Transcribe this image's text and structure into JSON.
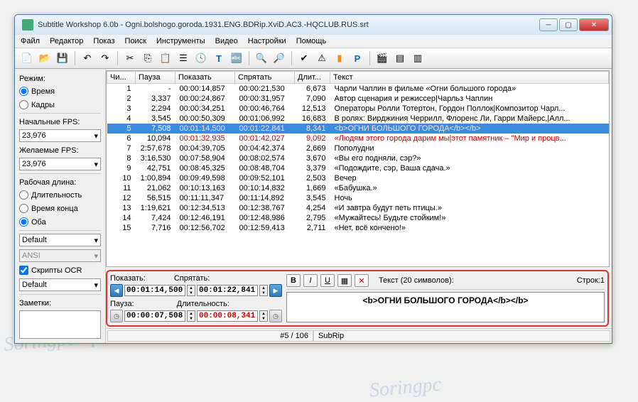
{
  "title": "Subtitle Workshop 6.0b - Ogni.bolshogo.goroda.1931.ENG.BDRip.XviD.AC3.-HQCLUB.RUS.srt",
  "menu": [
    "Файл",
    "Редактор",
    "Показ",
    "Поиск",
    "Инструменты",
    "Видео",
    "Настройки",
    "Помощь"
  ],
  "sidebar": {
    "mode_label": "Режим:",
    "mode_time": "Время",
    "mode_frames": "Кадры",
    "start_fps_label": "Начальные FPS:",
    "start_fps": "23,976",
    "want_fps_label": "Желаемые FPS:",
    "want_fps": "23,976",
    "worklen_label": "Рабочая длина:",
    "worklen_dur": "Длительность",
    "worklen_end": "Время конца",
    "worklen_both": "Оба",
    "combo1": "Default",
    "combo2": "ANSI",
    "ocr_label": "Скрипты OCR",
    "combo3": "Default",
    "notes": "Заметки:"
  },
  "cols": {
    "num": "Чи...",
    "pause": "Пауза",
    "show": "Показать",
    "hide": "Спрятать",
    "dur": "Длит...",
    "text": "Текст"
  },
  "rows": [
    {
      "n": "1",
      "pause": "-",
      "show": "00:00:14,857",
      "hide": "00:00:21,530",
      "dur": "6,673",
      "text": "Чарли Чаплин в фильме «Огни большого города»"
    },
    {
      "n": "2",
      "pause": "3,337",
      "show": "00:00:24,867",
      "hide": "00:00:31,957",
      "dur": "7,090",
      "text": "Автор сценария и режиссер|Чарльз Чаплин"
    },
    {
      "n": "3",
      "pause": "2,294",
      "show": "00:00:34,251",
      "hide": "00:00:46,764",
      "dur": "12,513",
      "text": "Операторы Ролли Тотертон, Гордон Поллок|Композитор Чарл..."
    },
    {
      "n": "4",
      "pause": "3,545",
      "show": "00:00:50,309",
      "hide": "00:01:06,992",
      "dur": "16,683",
      "text": "В ролях: Вирджиния Черрилл, Флоренс Ли, Гарри Майерс,|Алл..."
    },
    {
      "n": "5",
      "pause": "7,508",
      "show": "00:01:14,500",
      "hide": "00:01:22,841",
      "dur": "8,341",
      "text": "<b>ОГНИ БОЛЬШОГО ГОРОДА</b></b>",
      "red": true,
      "sel": true
    },
    {
      "n": "6",
      "pause": "10,094",
      "show": "00:01:32,935",
      "hide": "00:01:42,027",
      "dur": "9,092",
      "text": "«Людям этого города дарим мы|этот памятник – \"Мир и процв...",
      "red": true
    },
    {
      "n": "7",
      "pause": "2:57,678",
      "show": "00:04:39,705",
      "hide": "00:04:42,374",
      "dur": "2,669",
      "text": "Пополудни"
    },
    {
      "n": "8",
      "pause": "3:16,530",
      "show": "00:07:58,904",
      "hide": "00:08:02,574",
      "dur": "3,670",
      "text": "«Вы его подняли, сэр?»"
    },
    {
      "n": "9",
      "pause": "42,751",
      "show": "00:08:45,325",
      "hide": "00:08:48,704",
      "dur": "3,379",
      "text": "«Подождите, сэр, Ваша сдача.»"
    },
    {
      "n": "10",
      "pause": "1:00,894",
      "show": "00:09:49,598",
      "hide": "00:09:52,101",
      "dur": "2,503",
      "text": "Вечер"
    },
    {
      "n": "11",
      "pause": "21,062",
      "show": "00:10:13,163",
      "hide": "00:10:14,832",
      "dur": "1,669",
      "text": "«Бабушка.»"
    },
    {
      "n": "12",
      "pause": "56,515",
      "show": "00:11:11,347",
      "hide": "00:11:14,892",
      "dur": "3,545",
      "text": "Ночь"
    },
    {
      "n": "13",
      "pause": "1:19,621",
      "show": "00:12:34,513",
      "hide": "00:12:38,767",
      "dur": "4,254",
      "text": "«И завтра будут петь птицы.»"
    },
    {
      "n": "14",
      "pause": "7,424",
      "show": "00:12:46,191",
      "hide": "00:12:48,986",
      "dur": "2,795",
      "text": "«Мужайтесь! Будьте стойким!»"
    },
    {
      "n": "15",
      "pause": "7,716",
      "show": "00:12:56,702",
      "hide": "00:12:59,413",
      "dur": "2,711",
      "text": "«Нет, всё кончено!»"
    }
  ],
  "editor": {
    "show_lbl": "Показать:",
    "hide_lbl": "Спрятать:",
    "pause_lbl": "Пауза:",
    "dur_lbl": "Длительность:",
    "show_val": "00:01:14,500",
    "hide_val": "00:01:22,841",
    "pause_val": "00:00:07,508",
    "dur_val": "00:00:08,341",
    "text_lbl": "Текст (20 символов):",
    "lines_lbl": "Строк:1",
    "text_val": "<b>ОГНИ БОЛЬШОГО ГОРОДА</b></b>"
  },
  "status": {
    "pos": "#5 / 106",
    "fmt": "SubRip"
  }
}
